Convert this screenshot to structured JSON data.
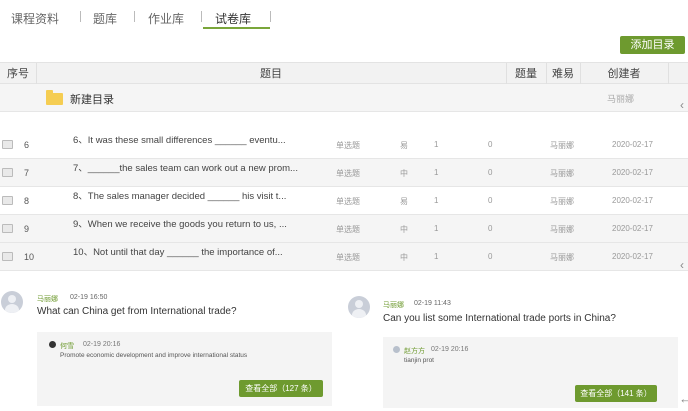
{
  "tabs": [
    {
      "label": "课程资料"
    },
    {
      "label": "题库"
    },
    {
      "label": "作业库"
    },
    {
      "label": "试卷库"
    }
  ],
  "toolbar": {
    "add_folder_label": "添加目录"
  },
  "table": {
    "headers": {
      "index": "序号",
      "title": "题目",
      "count": "题量",
      "difficulty": "难易",
      "creator": "创建者"
    },
    "folder": {
      "name": "新建目录",
      "creator": "马丽娜"
    },
    "rows": [
      {
        "num": "6",
        "title": "6、It was these small differences ______ eventu...",
        "type": "单选题",
        "difficulty": "易",
        "a": "1",
        "b": "0",
        "creator": "马丽娜",
        "date": "2020-02-17"
      },
      {
        "num": "7",
        "title": "7、______the sales team can work out a new prom...",
        "type": "单选题",
        "difficulty": "中",
        "a": "1",
        "b": "0",
        "creator": "马丽娜",
        "date": "2020-02-17"
      },
      {
        "num": "8",
        "title": "8、The sales manager decided ______ his visit t...",
        "type": "单选题",
        "difficulty": "易",
        "a": "1",
        "b": "0",
        "creator": "马丽娜",
        "date": "2020-02-17"
      },
      {
        "num": "9",
        "title": "9、When we receive the goods you return to us, ...",
        "type": "单选题",
        "difficulty": "中",
        "a": "1",
        "b": "0",
        "creator": "马丽娜",
        "date": "2020-02-17"
      },
      {
        "num": "10",
        "title": "10、Not until that day ______ the importance of...",
        "type": "单选题",
        "difficulty": "中",
        "a": "1",
        "b": "0",
        "creator": "马丽娜",
        "date": "2020-02-17"
      }
    ]
  },
  "comments": [
    {
      "name": "马丽娜",
      "time": "02-19 16:50",
      "question": "What can China get from International trade?",
      "answer": {
        "name": "何雪",
        "time": "02-19 20:16",
        "text": "Promote economic development and improve international status",
        "avatar_color": "#333333"
      },
      "view_all": "查看全部（127 条）"
    },
    {
      "name": "马丽娜",
      "time": "02-19 11:43",
      "question": "Can you list some International trade ports in China?",
      "answer": {
        "name": "赵方方",
        "time": "02-19 20:16",
        "text": "tianjin prot",
        "avatar_color": "#b8c0cc"
      },
      "view_all": "查看全部（141 条）"
    }
  ],
  "colors": {
    "accent": "#6e9a2f",
    "folder": "#f5cd52"
  }
}
